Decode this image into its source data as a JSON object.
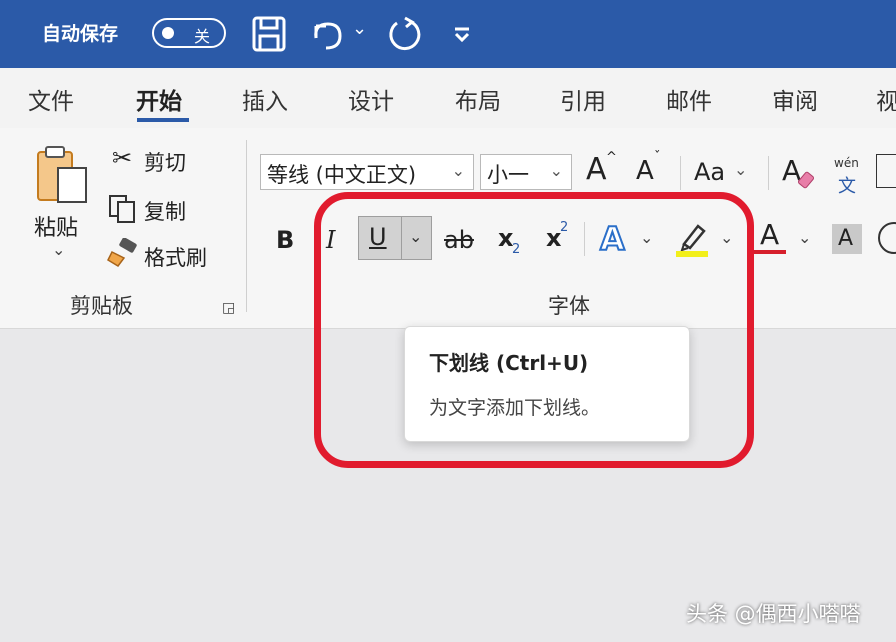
{
  "titlebar": {
    "autosave_label": "自动保存",
    "autosave_state": "关",
    "icons": [
      "save-icon",
      "undo-icon",
      "redo-icon",
      "customize-quick-access-icon"
    ]
  },
  "tabs": [
    {
      "label": "文件",
      "active": false
    },
    {
      "label": "开始",
      "active": true
    },
    {
      "label": "插入",
      "active": false
    },
    {
      "label": "设计",
      "active": false
    },
    {
      "label": "布局",
      "active": false
    },
    {
      "label": "引用",
      "active": false
    },
    {
      "label": "邮件",
      "active": false
    },
    {
      "label": "审阅",
      "active": false
    },
    {
      "label": "视",
      "active": false
    }
  ],
  "clipboard": {
    "paste": "粘贴",
    "cut": "剪切",
    "copy": "复制",
    "format_painter": "格式刷",
    "group_label": "剪贴板"
  },
  "font": {
    "font_name": "等线 (中文正文)",
    "font_size": "小一",
    "change_case": "Aa",
    "phonetic_top": "wén",
    "phonetic_bottom": "文",
    "bold": "B",
    "italic": "I",
    "underline": "U",
    "strike": "ab",
    "sub": "x",
    "sub_mark": "2",
    "sup": "x",
    "sup_mark": "2",
    "text_effect": "A",
    "font_color": "A",
    "char_shading": "A",
    "group_label": "字体"
  },
  "tooltip": {
    "title": "下划线 (Ctrl+U)",
    "description": "为文字添加下划线。"
  },
  "watermark": "头条 @偶西小嗒嗒",
  "colors": {
    "titlebar": "#2b5aa8",
    "annotation": "#e11b2e",
    "highlight": "#f2ef1b",
    "font_color_bar": "#d61f2c"
  }
}
